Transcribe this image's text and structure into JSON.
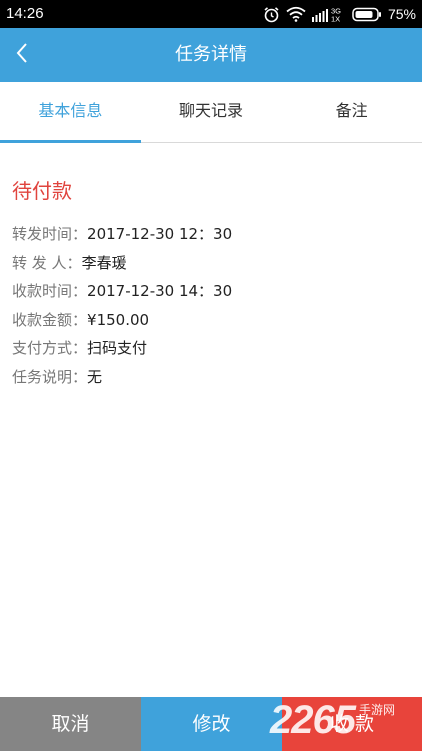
{
  "status_bar": {
    "time": "14:26",
    "network": "3G 1X",
    "battery": "75%"
  },
  "header": {
    "title": "任务详情",
    "back_icon": "chevron-left-icon"
  },
  "tabs": [
    {
      "label": "基本信息",
      "active": true
    },
    {
      "label": "聊天记录",
      "active": false
    },
    {
      "label": "备注",
      "active": false
    }
  ],
  "task": {
    "status": "待付款",
    "fields": [
      {
        "label": "转发时间",
        "value": "2017-12-30  12：30"
      },
      {
        "label": "转 发 人",
        "value": "李春瑗"
      },
      {
        "label": "收款时间",
        "value": "2017-12-30  14：30"
      },
      {
        "label": "收款金额",
        "value": "¥150.00"
      },
      {
        "label": "支付方式",
        "value": "扫码支付"
      },
      {
        "label": "任务说明",
        "value": "无"
      }
    ],
    "separator": "："
  },
  "actions": {
    "cancel": "取消",
    "edit": "修改",
    "collect": "收 款"
  },
  "watermark": {
    "number": "2265",
    "text": "手游网"
  },
  "colors": {
    "primary": "#3fa2db",
    "danger": "#e8443b",
    "status_red": "#e0443e",
    "gray_button": "#858585"
  }
}
